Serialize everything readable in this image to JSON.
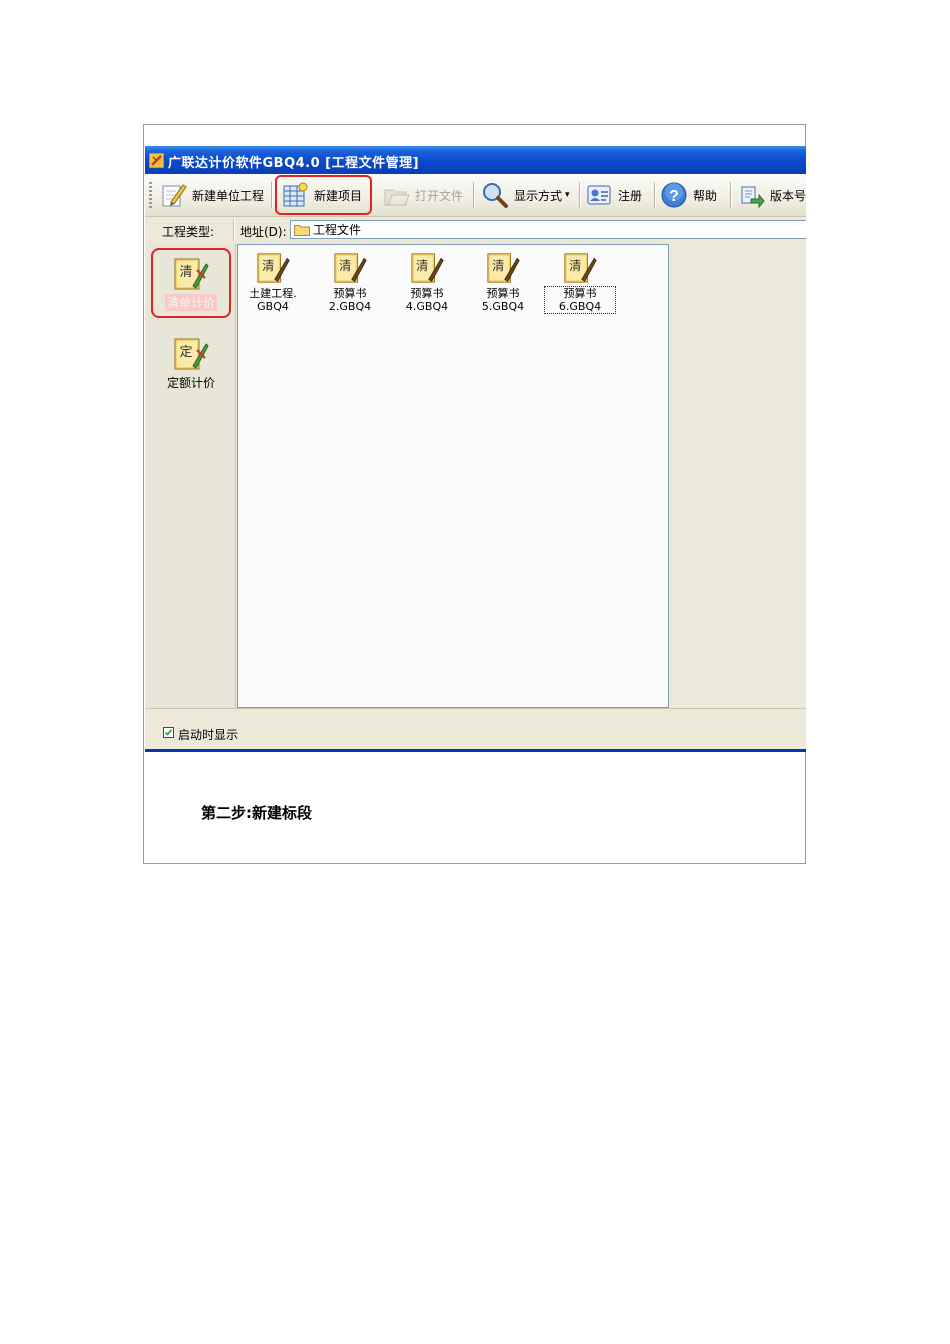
{
  "window": {
    "title": "广联达计价软件GBQ4.0 [工程文件管理]"
  },
  "toolbar": {
    "new_unit_label": "新建单位工程",
    "new_project_label": "新建项目",
    "open_file_label": "打开文件",
    "display_mode_label": "显示方式",
    "register_label": "注册",
    "help_label": "帮助",
    "version_label": "版本号"
  },
  "address": {
    "type_label": "工程类型:",
    "addr_label": "地址(D):",
    "path": "工程文件"
  },
  "project_types": [
    {
      "label": "清单计价",
      "glyph": "清",
      "selected": true
    },
    {
      "label": "定额计价",
      "glyph": "定",
      "selected": false
    }
  ],
  "files": [
    {
      "line1": "土建工程.",
      "line2": "GBQ4",
      "glyph": "清"
    },
    {
      "line1": "预算书",
      "line2": "2.GBQ4",
      "glyph": "清"
    },
    {
      "line1": "预算书",
      "line2": "4.GBQ4",
      "glyph": "清"
    },
    {
      "line1": "预算书",
      "line2": "5.GBQ4",
      "glyph": "清"
    },
    {
      "line1": "预算书",
      "line2": "6.GBQ4",
      "glyph": "清"
    }
  ],
  "status": {
    "show_on_start_label": "启动时显示",
    "show_on_start_checked": true
  },
  "caption": {
    "text": "第二步:新建标段"
  },
  "colors": {
    "titlebar": "#0a47c9",
    "highlight": "#e02424",
    "icon_gold": "#e9b431"
  }
}
